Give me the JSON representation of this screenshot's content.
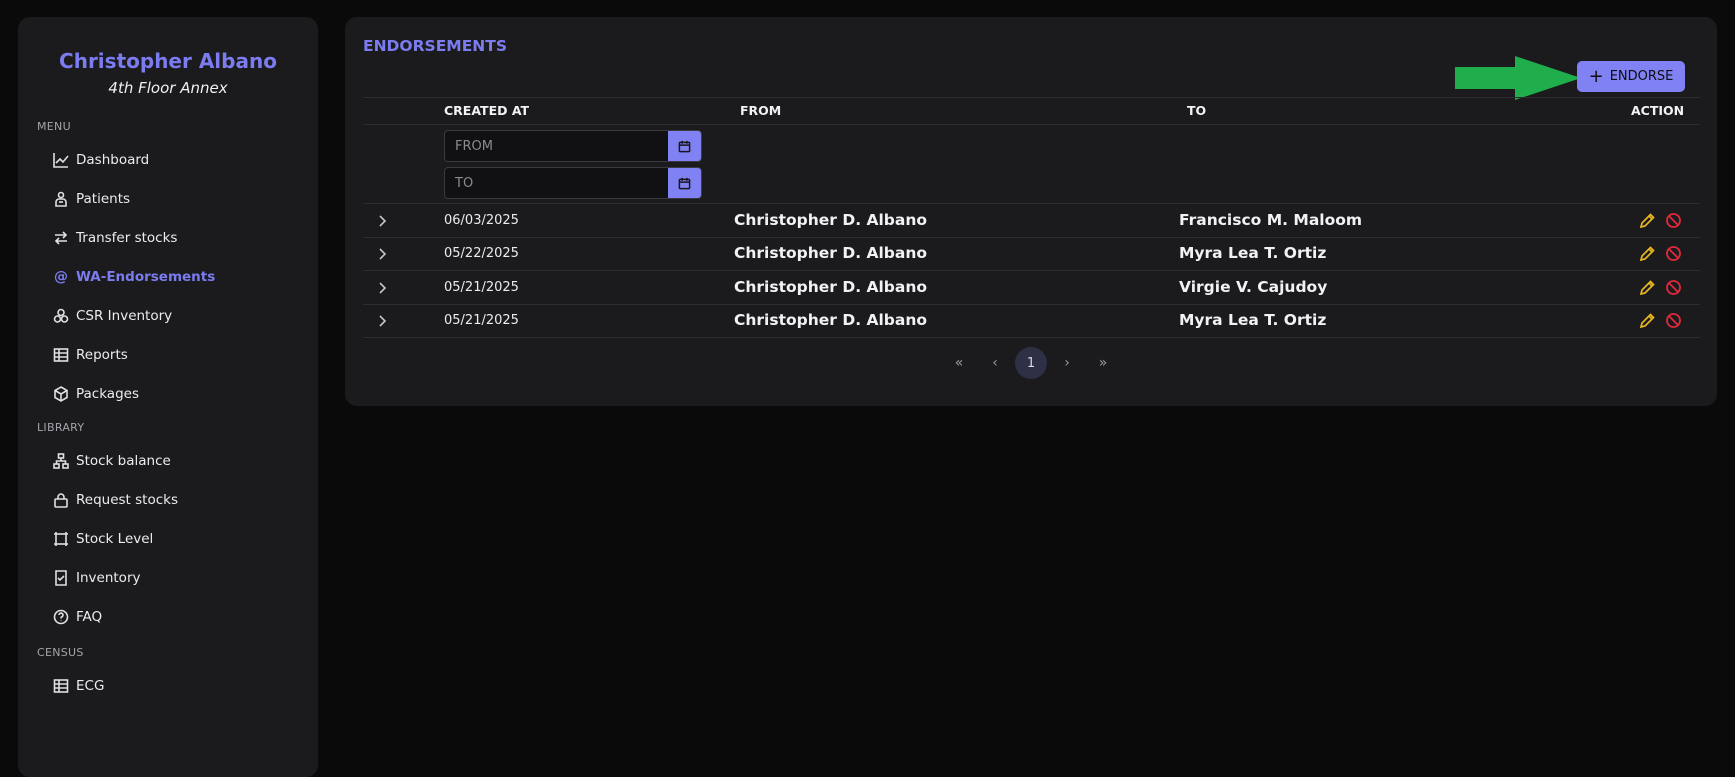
{
  "sidebar": {
    "user_name": "Christopher Albano",
    "location": "4th Floor Annex",
    "sections": {
      "menu": "MENU",
      "library": "LIBRARY",
      "census": "CENSUS"
    },
    "menu_items": [
      {
        "label": "Dashboard",
        "icon": "chart-line-icon"
      },
      {
        "label": "Patients",
        "icon": "patient-icon"
      },
      {
        "label": "Transfer stocks",
        "icon": "transfer-arrows-icon"
      },
      {
        "label": "WA-Endorsements",
        "icon": "at-icon",
        "active": true
      },
      {
        "label": "CSR Inventory",
        "icon": "boxes-icon"
      },
      {
        "label": "Reports",
        "icon": "spreadsheet-icon"
      },
      {
        "label": "Packages",
        "icon": "package-icon"
      }
    ],
    "library_items": [
      {
        "label": "Stock balance",
        "icon": "hierarchy-icon"
      },
      {
        "label": "Request stocks",
        "icon": "lock-bag-icon"
      },
      {
        "label": "Stock Level",
        "icon": "frame-icon"
      },
      {
        "label": "Inventory",
        "icon": "checklist-icon"
      },
      {
        "label": "FAQ",
        "icon": "question-icon"
      }
    ],
    "census_items": [
      {
        "label": "ECG",
        "icon": "spreadsheet-icon"
      }
    ]
  },
  "main": {
    "title": "ENDORSEMENTS",
    "endorse_button": "ENDORSE",
    "columns": {
      "created_at": "CREATED AT",
      "from": "FROM",
      "to": "TO",
      "action": "ACTION"
    },
    "filters": {
      "from_placeholder": "FROM",
      "to_placeholder": "TO"
    },
    "rows": [
      {
        "date": "06/03/2025",
        "from": "Christopher D. Albano",
        "to": "Francisco M. Maloom"
      },
      {
        "date": "05/22/2025",
        "from": "Christopher D. Albano",
        "to": "Myra Lea T. Ortiz"
      },
      {
        "date": "05/21/2025",
        "from": "Christopher D. Albano",
        "to": "Virgie V. Cajudoy"
      },
      {
        "date": "05/21/2025",
        "from": "Christopher D. Albano",
        "to": "Myra Lea T. Ortiz"
      }
    ],
    "pagination": {
      "current_page": "1",
      "first": "«",
      "prev": "‹",
      "next": "›",
      "last": "»"
    }
  },
  "colors": {
    "accent": "#8081f2",
    "edit": "#e8b722",
    "delete": "#e3283b",
    "arrow": "#1fae4b"
  }
}
